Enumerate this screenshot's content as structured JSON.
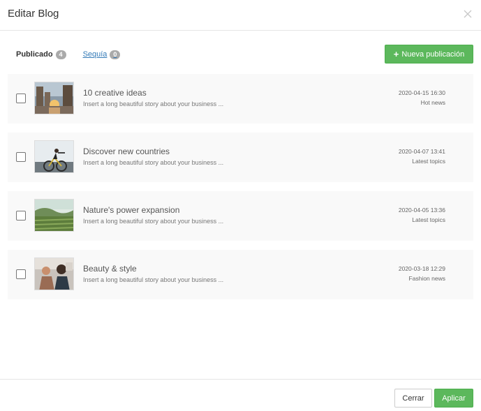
{
  "dialog": {
    "title": "Editar Blog"
  },
  "tabs": {
    "published_label": "Publicado",
    "published_count": "4",
    "draft_label": "Sequía",
    "draft_count": "0"
  },
  "toolbar": {
    "new_post_label": "Nueva publicación"
  },
  "posts": [
    {
      "title": "10 creative ideas",
      "excerpt": "Insert a long beautiful story about your business ...",
      "date": "2020-04-15 16:30",
      "category": "Hot news"
    },
    {
      "title": "Discover new countries",
      "excerpt": "Insert a long beautiful story about your business ...",
      "date": "2020-04-07 13:41",
      "category": "Latest topics"
    },
    {
      "title": "Nature's power expansion",
      "excerpt": "Insert a long beautiful story about your business ...",
      "date": "2020-04-05 13:36",
      "category": "Latest topics"
    },
    {
      "title": "Beauty & style",
      "excerpt": "Insert a long beautiful story about your business ...",
      "date": "2020-03-18 12:29",
      "category": "Fashion news"
    }
  ],
  "footer": {
    "close_label": "Cerrar",
    "apply_label": "Aplicar"
  },
  "colors": {
    "primary_green": "#5cb85c",
    "link_blue": "#337ab7",
    "badge_gray": "#aaaaaa"
  },
  "icons": {
    "close": "close-icon",
    "plus": "plus-icon"
  }
}
